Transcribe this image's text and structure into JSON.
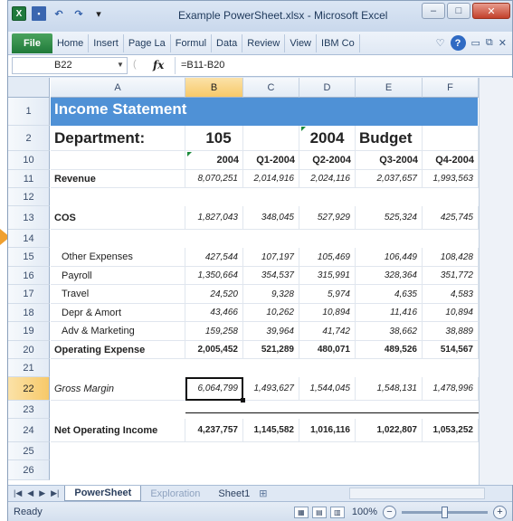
{
  "window": {
    "title": "Example PowerSheet.xlsx - Microsoft Excel",
    "minimize": "–",
    "maximize": "□",
    "close": "✕"
  },
  "qat": {
    "app_icon": "X",
    "save": "▪",
    "undo": "↶",
    "redo": "↷",
    "customize": "▾"
  },
  "ribbon": {
    "file_tab": "File",
    "tabs": [
      "Home",
      "Insert",
      "Page La",
      "Formul",
      "Data",
      "Review",
      "View",
      "IBM Co"
    ],
    "help": "?"
  },
  "formula_bar": {
    "name_box": "B22",
    "fx": "fx",
    "formula": "=B11-B20"
  },
  "columns": [
    "A",
    "B",
    "C",
    "D",
    "E",
    "F"
  ],
  "rows": {
    "r1": {
      "num": "1",
      "title": "Income Statement"
    },
    "r2": {
      "num": "2",
      "label": "Department:",
      "b": "105",
      "d": "2004",
      "e": "Budget"
    },
    "r10": {
      "num": "10",
      "b": "2004",
      "c": "Q1-2004",
      "d": "Q2-2004",
      "e": "Q3-2004",
      "f": "Q4-2004"
    },
    "r11": {
      "num": "11",
      "label": "Revenue",
      "b": "8,070,251",
      "c": "2,014,916",
      "d": "2,024,116",
      "e": "2,037,657",
      "f": "1,993,563"
    },
    "r12": {
      "num": "12"
    },
    "r13": {
      "num": "13",
      "label": "COS",
      "b": "1,827,043",
      "c": "348,045",
      "d": "527,929",
      "e": "525,324",
      "f": "425,745"
    },
    "r14": {
      "num": "14"
    },
    "r15": {
      "num": "15",
      "label": "Other Expenses",
      "b": "427,544",
      "c": "107,197",
      "d": "105,469",
      "e": "106,449",
      "f": "108,428"
    },
    "r16": {
      "num": "16",
      "label": "Payroll",
      "b": "1,350,664",
      "c": "354,537",
      "d": "315,991",
      "e": "328,364",
      "f": "351,772"
    },
    "r17": {
      "num": "17",
      "label": "Travel",
      "b": "24,520",
      "c": "9,328",
      "d": "5,974",
      "e": "4,635",
      "f": "4,583"
    },
    "r18": {
      "num": "18",
      "label": "Depr & Amort",
      "b": "43,466",
      "c": "10,262",
      "d": "10,894",
      "e": "11,416",
      "f": "10,894"
    },
    "r19": {
      "num": "19",
      "label": "Adv & Marketing",
      "b": "159,258",
      "c": "39,964",
      "d": "41,742",
      "e": "38,662",
      "f": "38,889"
    },
    "r20": {
      "num": "20",
      "label": "Operating Expense",
      "b": "2,005,452",
      "c": "521,289",
      "d": "480,071",
      "e": "489,526",
      "f": "514,567"
    },
    "r21": {
      "num": "21"
    },
    "r22": {
      "num": "22",
      "label": "Gross Margin",
      "b": "6,064,799",
      "c": "1,493,627",
      "d": "1,544,045",
      "e": "1,548,131",
      "f": "1,478,996"
    },
    "r23": {
      "num": "23"
    },
    "r24": {
      "num": "24",
      "label": "Net Operating Income",
      "b": "4,237,757",
      "c": "1,145,582",
      "d": "1,016,116",
      "e": "1,022,807",
      "f": "1,053,252"
    },
    "r25": {
      "num": "25"
    },
    "r26": {
      "num": "26"
    }
  },
  "sheets": [
    "PowerSheet",
    "Exploration",
    "Sheet1"
  ],
  "status": {
    "text": "Ready",
    "zoom": "100%",
    "zoom_out": "−",
    "zoom_in": "+",
    "zoom_fraction": 0.5
  }
}
